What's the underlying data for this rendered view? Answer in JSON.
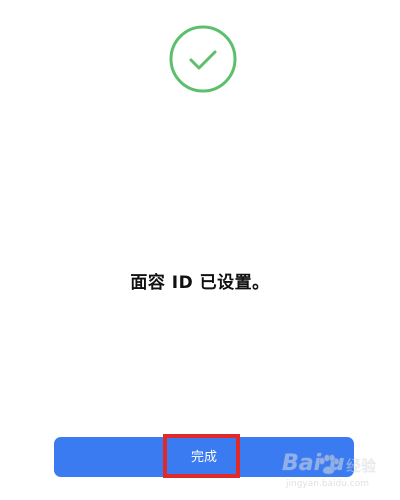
{
  "status": {
    "message": "面容 ID 已设置。"
  },
  "done_button": {
    "label": "完成"
  },
  "watermark": {
    "brand": "Bai  u",
    "site_cn": "经验",
    "url": "jingyan.baidu.com"
  },
  "colors": {
    "check_green": "#5cbf6c",
    "button_blue": "#3a7bf2",
    "highlight_red": "#e02a2a"
  },
  "icons": {
    "success": "checkmark-circle-icon",
    "watermark_logo": "paw-icon"
  }
}
